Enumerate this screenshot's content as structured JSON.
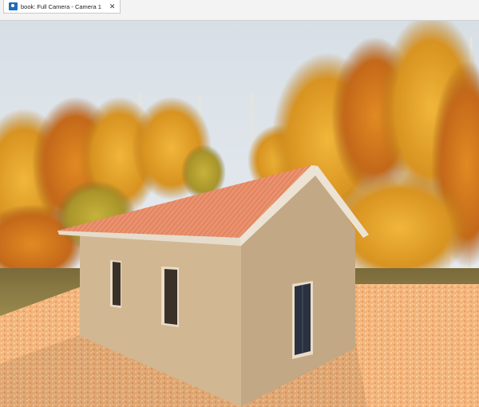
{
  "tabs": [
    {
      "label": "book: Full Camera - Camera 1",
      "icon": "camera-view-icon",
      "active": true
    }
  ],
  "colors": {
    "sky": "#dfe6ec",
    "foliage_gold": "#e0a21c",
    "foliage_orange": "#c9741a",
    "roof": "#e58a68",
    "wall": "#d2b896",
    "ground_tile": "#f0b27a"
  }
}
